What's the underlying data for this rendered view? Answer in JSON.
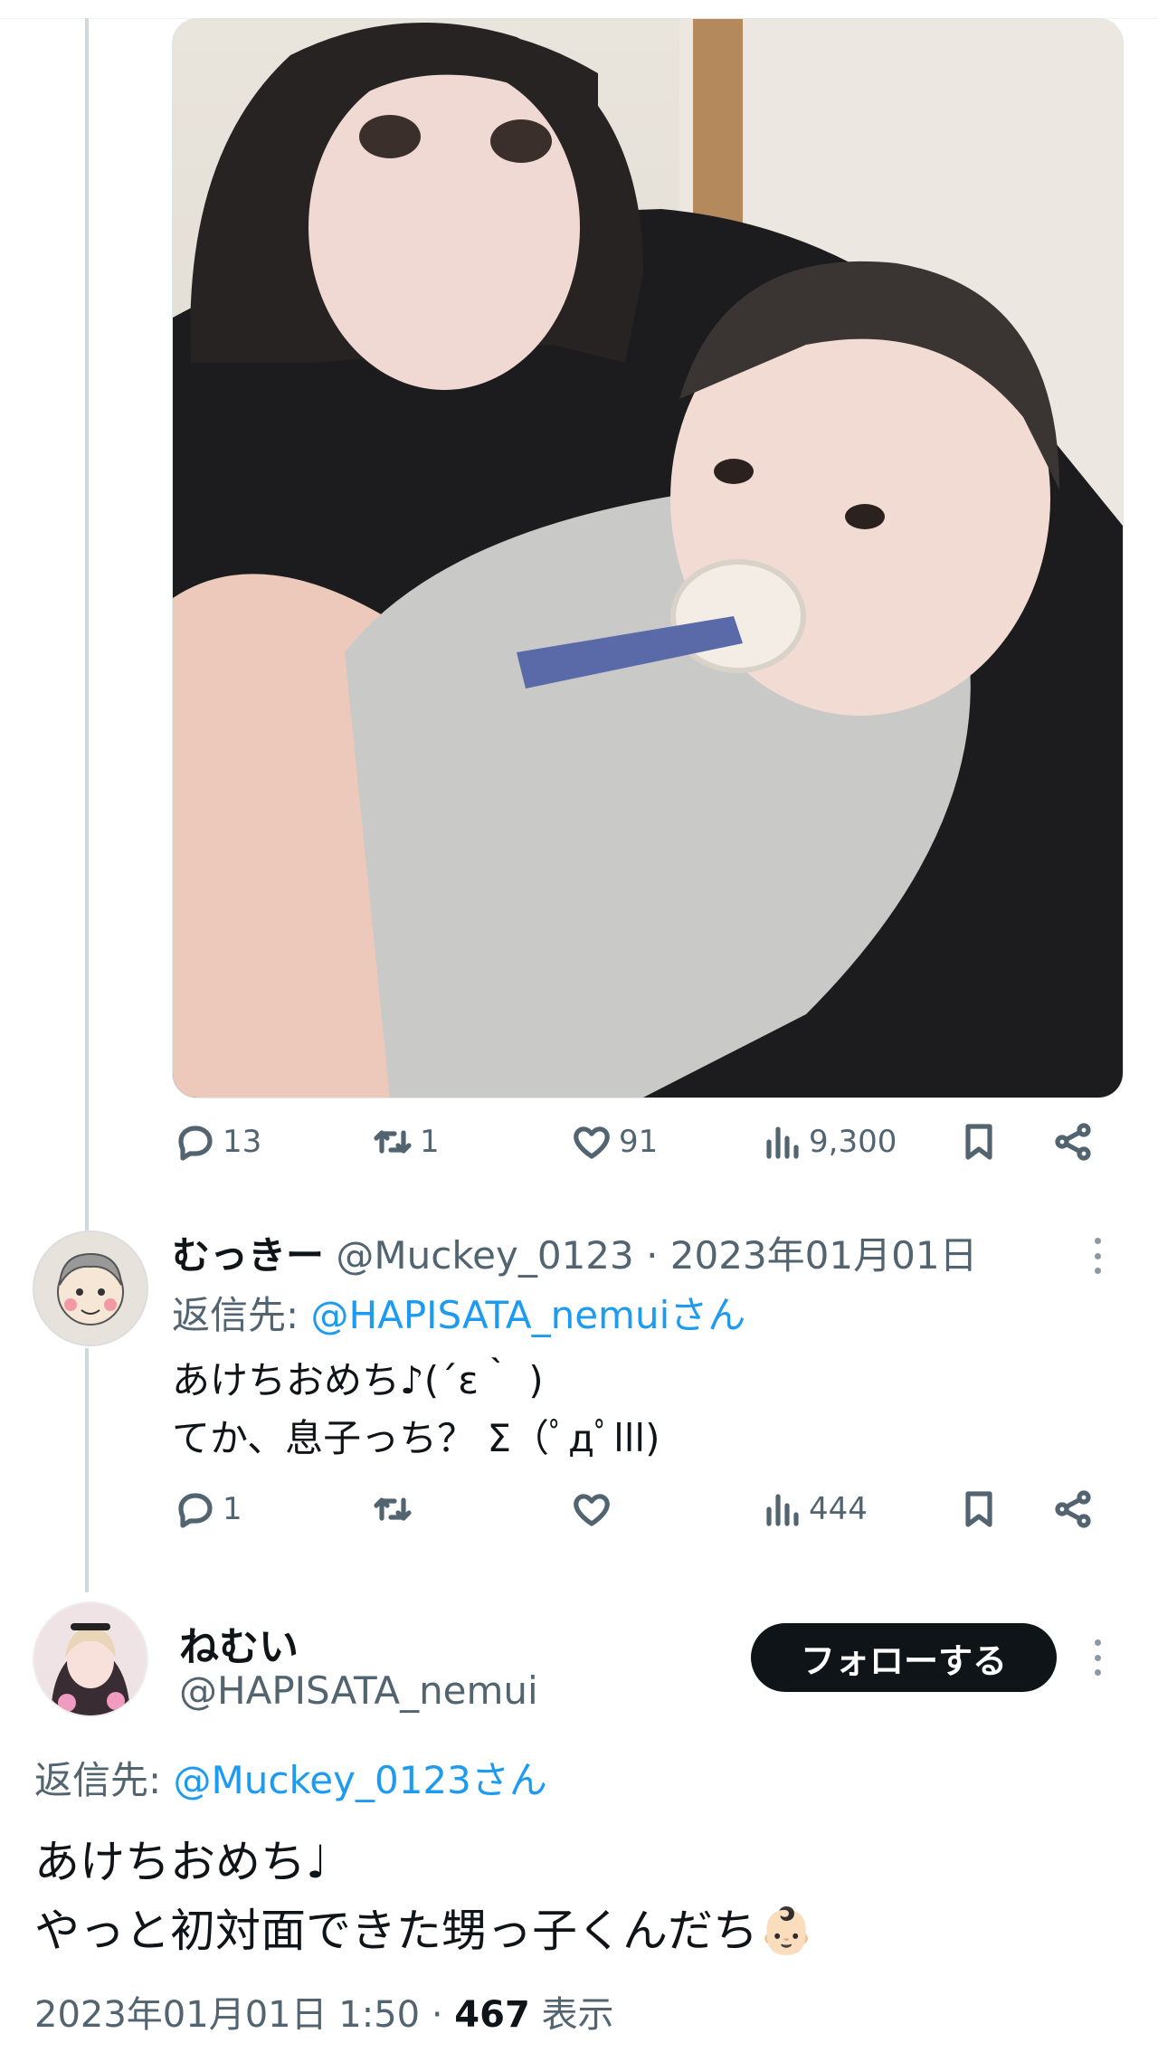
{
  "top_tweet": {
    "photo_alt": "photo",
    "stats": {
      "replies": "13",
      "retweets": "1",
      "likes": "91",
      "views": "9,300"
    }
  },
  "reply": {
    "display_name": "むっきー",
    "handle_date": "@Muckey_0123 · 2023年01月01日",
    "reply_to_label": "返信先: ",
    "reply_to_handle": "@HAPISATA_nemuiさん",
    "line1": "あけちおめち♪(´ε｀ )",
    "line2": "てか、息子っち？ Σ（ﾟдﾟlll)",
    "stats": {
      "replies": "1",
      "retweets": "",
      "likes": "",
      "views": "444"
    }
  },
  "main_tweet": {
    "display_name": "ねむい",
    "handle": "@HAPISATA_nemui",
    "follow_label": "フォローする",
    "reply_to_label": "返信先: ",
    "reply_to_handle": "@Muckey_0123さん",
    "line1": "あけちおめち♩",
    "line2": "やっと初対面できた甥っ子くんだち",
    "emoji": "👶🏻",
    "timestamp": "2023年01月01日 1:50 · ",
    "view_count": "467",
    "view_label": " 表示"
  },
  "icons": [
    "reply-icon",
    "retweet-icon",
    "like-icon",
    "views-icon",
    "bookmark-icon",
    "share-icon",
    "more-icon"
  ],
  "colors": {
    "link": "#1d9bf0",
    "muted": "#536471",
    "text": "#0f1419",
    "follow_bg": "#0f1419"
  }
}
